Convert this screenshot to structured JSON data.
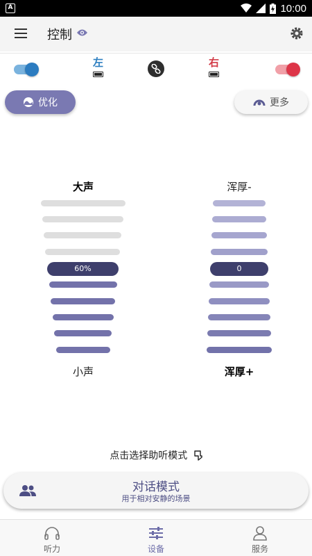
{
  "status_bar": {
    "badge": "A",
    "time": "10:00"
  },
  "app_bar": {
    "title": "控制"
  },
  "devices": {
    "left_label": "左",
    "right_label": "右",
    "left_enabled": true,
    "right_enabled": true
  },
  "buttons": {
    "optimize": "优化",
    "more": "更多"
  },
  "volume": {
    "top_label": "大声",
    "bottom_label": "小声",
    "value_label": "60%",
    "level": 0.6
  },
  "tone": {
    "top_label": "浑厚-",
    "bottom_label": "浑厚+",
    "value_label": "0"
  },
  "hint": {
    "text": "点击选择助听模式"
  },
  "mode": {
    "title": "对话模式",
    "subtitle": "用于相对安静的场景"
  },
  "nav": {
    "hearing": "听力",
    "device": "设备",
    "service": "服务",
    "active": "device"
  },
  "colors": {
    "accent": "#7a79b2",
    "left": "#2e7fc1",
    "right": "#d23b47",
    "selected": "#3e3f6c"
  }
}
